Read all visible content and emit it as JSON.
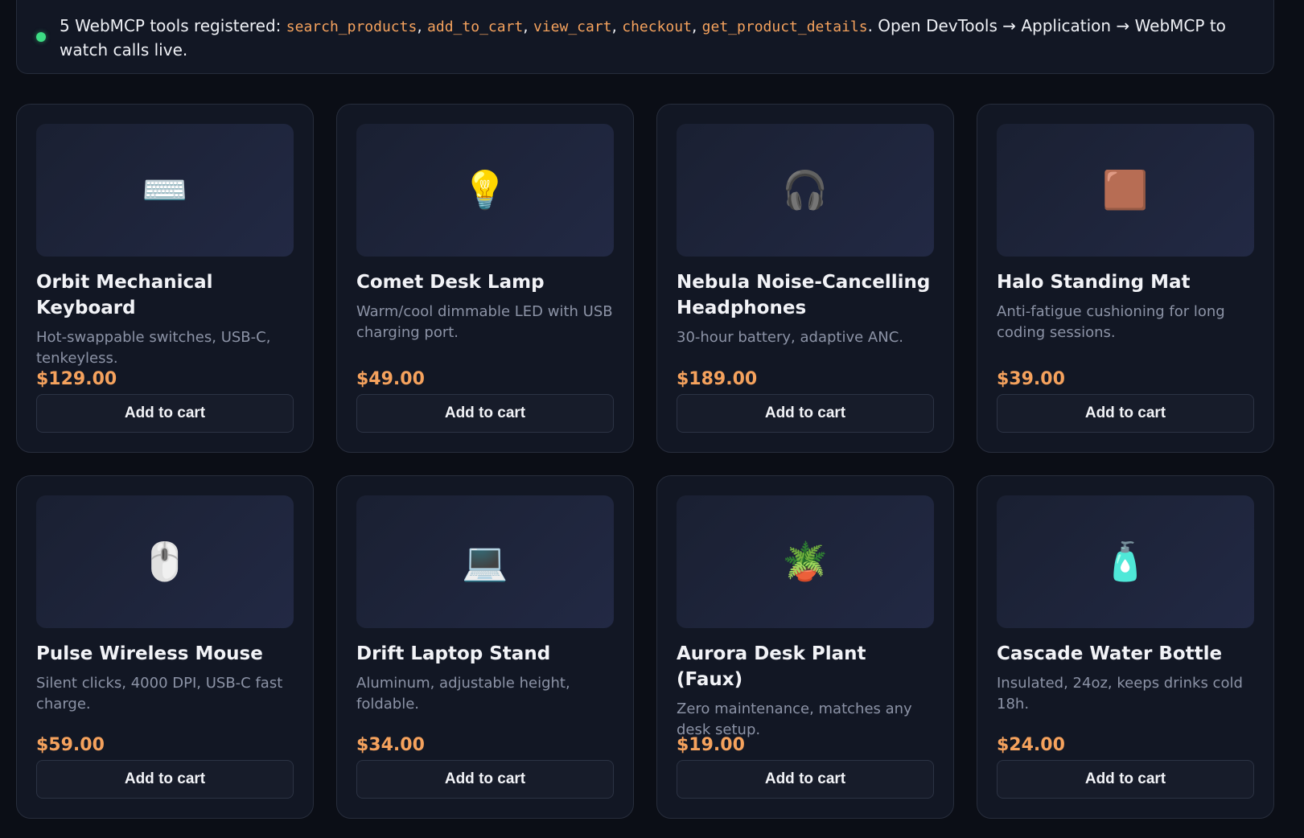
{
  "banner": {
    "count_text": "5 WebMCP tools registered: ",
    "tools": [
      "search_products",
      "add_to_cart",
      "view_cart",
      "checkout",
      "get_product_details"
    ],
    "suffix": ". Open DevTools → Application → WebMCP to watch calls live.",
    "status": "active"
  },
  "products": [
    {
      "icon": "keyboard-icon",
      "glyph": "⌨️",
      "name": "Orbit Mechanical Keyboard",
      "desc": "Hot-swappable switches, USB-C, tenkeyless.",
      "price": "$129.00",
      "button": "Add to cart"
    },
    {
      "icon": "lightbulb-icon",
      "glyph": "💡",
      "name": "Comet Desk Lamp",
      "desc": "Warm/cool dimmable LED with USB charging port.",
      "price": "$49.00",
      "button": "Add to cart"
    },
    {
      "icon": "headphones-icon",
      "glyph": "🎧",
      "name": "Nebula Noise-Cancelling Headphones",
      "desc": "30-hour battery, adaptive ANC.",
      "price": "$189.00",
      "button": "Add to cart"
    },
    {
      "icon": "mat-square-icon",
      "glyph": "🟫",
      "name": "Halo Standing Mat",
      "desc": "Anti-fatigue cushioning for long coding sessions.",
      "price": "$39.00",
      "button": "Add to cart"
    },
    {
      "icon": "mouse-icon",
      "glyph": "🖱️",
      "name": "Pulse Wireless Mouse",
      "desc": "Silent clicks, 4000 DPI, USB-C fast charge.",
      "price": "$59.00",
      "button": "Add to cart"
    },
    {
      "icon": "laptop-icon",
      "glyph": "💻",
      "name": "Drift Laptop Stand",
      "desc": "Aluminum, adjustable height, foldable.",
      "price": "$34.00",
      "button": "Add to cart"
    },
    {
      "icon": "potted-plant-icon",
      "glyph": "🪴",
      "name": "Aurora Desk Plant (Faux)",
      "desc": "Zero maintenance, matches any desk setup.",
      "price": "$19.00",
      "button": "Add to cart"
    },
    {
      "icon": "bottle-icon",
      "glyph": "🧴",
      "name": "Cascade Water Bottle",
      "desc": "Insulated, 24oz, keeps drinks cold 18h.",
      "price": "$24.00",
      "button": "Add to cart"
    }
  ],
  "colors": {
    "background": "#0b0e16",
    "card": "#121724",
    "accent_price": "#f5a25d",
    "status_dot": "#3ddc84"
  }
}
